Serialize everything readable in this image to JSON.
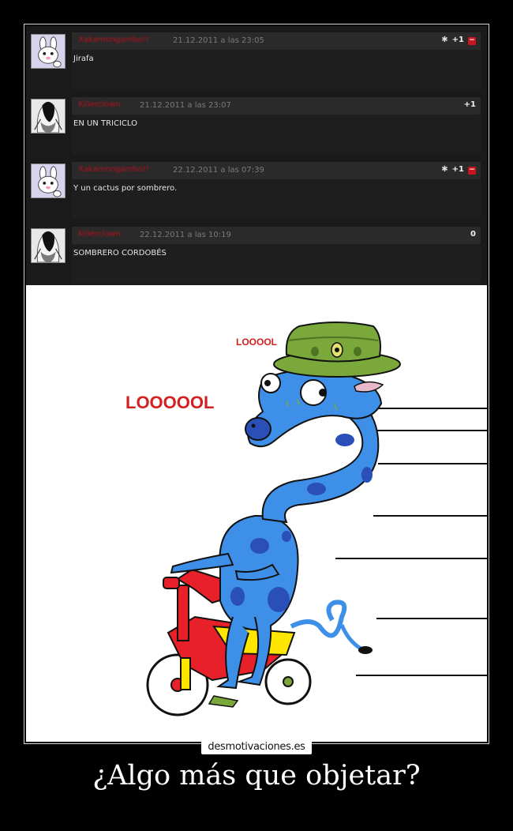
{
  "comments": [
    {
      "username": "Xakamongambo!!",
      "date": "21.12.2011 a las 23:05",
      "flag": "✱",
      "score": "+1",
      "minus": "−",
      "text": "Jirafa"
    },
    {
      "username": "Killerclown",
      "date": "21.12.2011 a las 23:07",
      "flag": "",
      "score": "+1",
      "minus": "",
      "text": "EN UN TRICICLO"
    },
    {
      "username": "Xakamongambo!!",
      "date": "22.12.2011 a las 07:39",
      "flag": "✱",
      "score": "+1",
      "minus": "−",
      "text": "Y un cactus por sombrero."
    },
    {
      "username": "Killerclown",
      "date": "22.12.2011 a las 10:19",
      "flag": "",
      "score": "0",
      "minus": "",
      "text": "SOMBRERO CORDOBÉS"
    }
  ],
  "drawing": {
    "label_small": "LOOOOL",
    "label_big": "LOOOOOL",
    "giraffe_color": "#3d8fe8",
    "spot_color": "#2a4fb8",
    "hat_color": "#7aa83a",
    "trike_color": "#e8202a",
    "seat_color": "#ffe600"
  },
  "watermark": "desmotivaciones.es",
  "caption": "¿Algo más que objetar?"
}
